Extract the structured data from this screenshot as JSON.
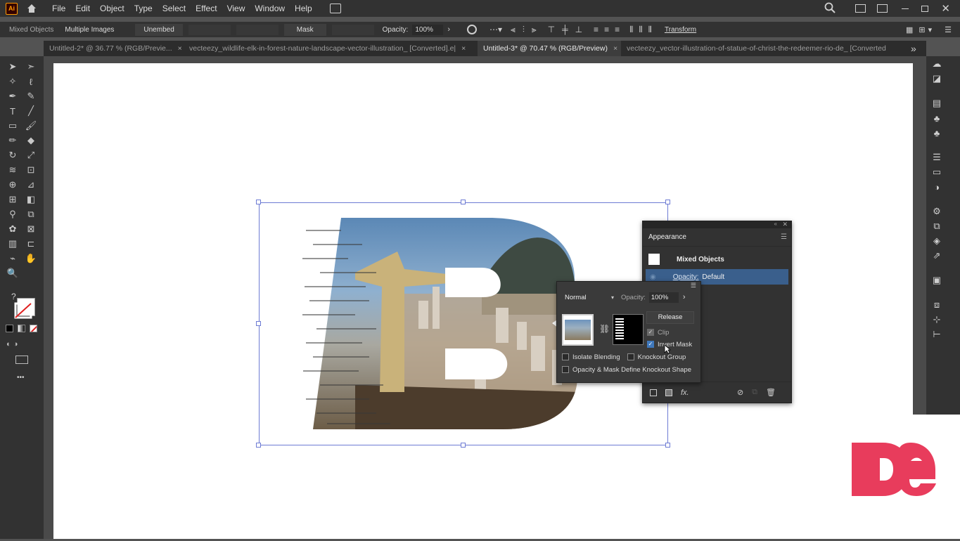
{
  "menubar": {
    "logo": "Ai",
    "items": [
      "File",
      "Edit",
      "Object",
      "Type",
      "Select",
      "Effect",
      "View",
      "Window",
      "Help"
    ]
  },
  "control_bar": {
    "selection_label": "Mixed Objects",
    "multiple_images": "Multiple Images",
    "unembed": "Unembed",
    "mask": "Mask",
    "opacity_label": "Opacity:",
    "opacity_value": "100%",
    "transform": "Transform"
  },
  "tabs": [
    {
      "label": "Untitled-2* @ 36.77 % (RGB/Previe...",
      "close": "×"
    },
    {
      "label": "vecteezy_wildlife-elk-in-forest-nature-landscape-vector-illustration_ [Converted].e|",
      "close": "×"
    },
    {
      "label": "Untitled-3* @ 70.47 % (RGB/Preview)",
      "close": "×"
    },
    {
      "label": "vecteezy_vector-illustration-of-statue-of-christ-the-redeemer-rio-de_ [Converted"
    }
  ],
  "tabs_overflow": "»",
  "appearance_panel": {
    "title": "Appearance",
    "object_label": "Mixed Objects",
    "opacity_label": "Opacity:",
    "opacity_value": "Default",
    "fx_label": "fx."
  },
  "transparency_panel": {
    "blend_mode": "Normal",
    "opacity_label": "Opacity:",
    "opacity_value": "100%",
    "release_button": "Release",
    "clip_label": "Clip",
    "clip_checked": true,
    "invert_mask_label": "Invert Mask",
    "invert_mask_checked": true,
    "isolate_blending_label": "Isolate Blending",
    "knockout_group_label": "Knockout Group",
    "opacity_mask_label": "Opacity & Mask Define Knockout Shape"
  },
  "left_tools": {
    "unknown_label": "?",
    "more_label": "•••"
  },
  "watermark": {
    "text": "De",
    "color": "#e83c5c"
  },
  "colors": {
    "accent": "#3f78bc",
    "selection": "#6d7bd4"
  }
}
